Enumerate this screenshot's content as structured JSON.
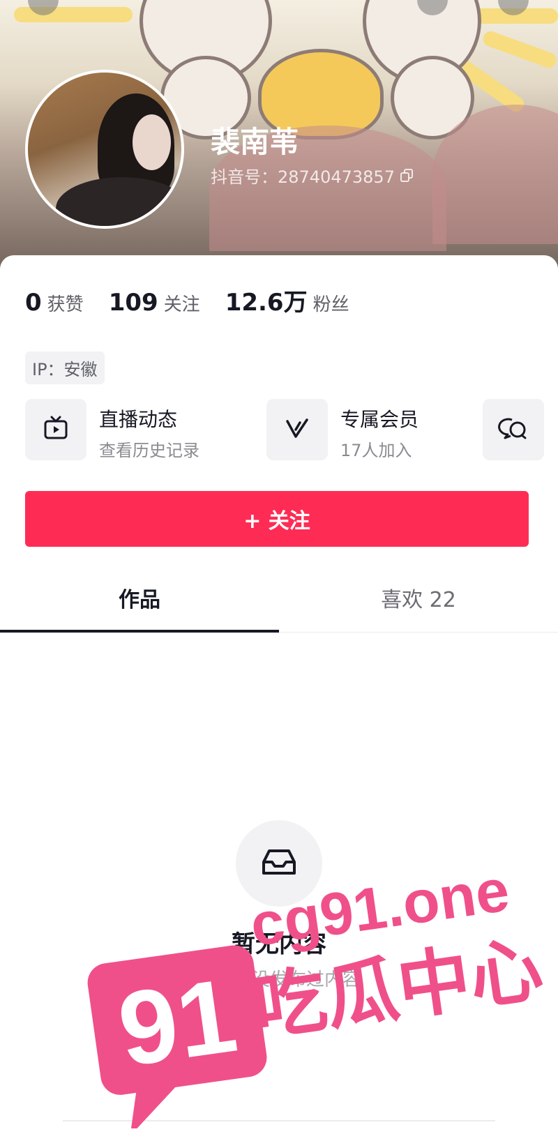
{
  "profile": {
    "nickname": "裴南苇",
    "douyin_id": "抖音号：28740473857"
  },
  "stats": [
    {
      "value": "0",
      "label": "获赞"
    },
    {
      "value": "109",
      "label": "关注"
    },
    {
      "value": "12.6万",
      "label": "粉丝"
    }
  ],
  "ip_tag": "IP：安徽",
  "entries": [
    {
      "title": "直播动态",
      "subtitle": "查看历史记录",
      "icon": "tv-play-icon"
    },
    {
      "title": "专属会员",
      "subtitle": "17人加入",
      "icon": "v-badge-icon"
    },
    {
      "icon": "chat-bubbles-icon"
    }
  ],
  "follow_button": "+ 关注",
  "tabs": [
    {
      "label": "作品",
      "active": true
    },
    {
      "label": "喜欢 22",
      "active": false
    }
  ],
  "empty_state": {
    "icon": "inbox-tray-icon",
    "title": "暂无内容",
    "subtitle": "对方还没发布过内容"
  },
  "watermark": {
    "badge_number": "91",
    "domain": "cg91.one",
    "slogan": "吃瓜中心",
    "color": "#f0508a"
  },
  "colors": {
    "accent": "#fe2c55",
    "text_primary": "#161823",
    "text_secondary": "#8a8b91"
  }
}
